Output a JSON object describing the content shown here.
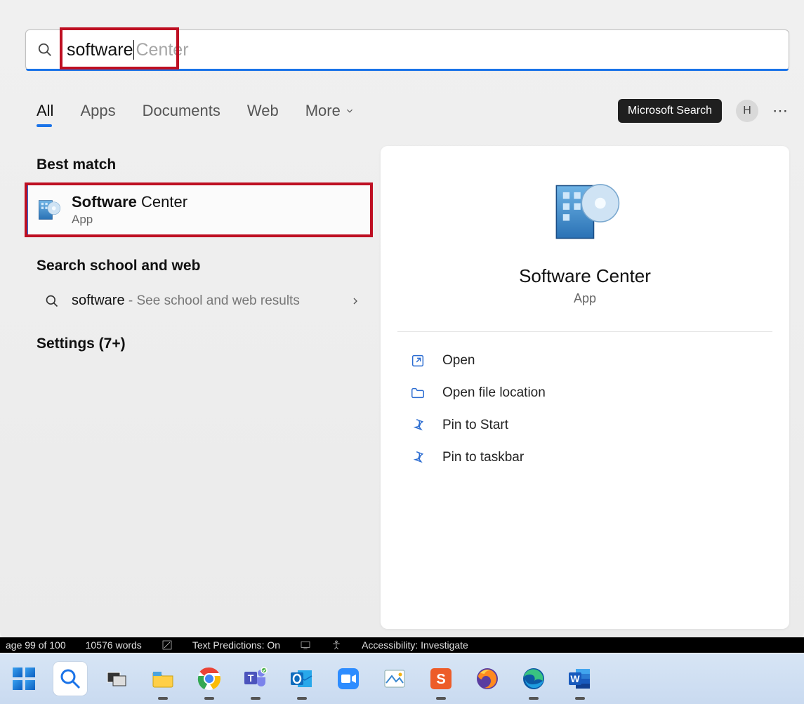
{
  "search": {
    "typed": "software",
    "suggestion_suffix": " Center"
  },
  "tabs": {
    "items": [
      {
        "label": "All",
        "active": true
      },
      {
        "label": "Apps",
        "active": false
      },
      {
        "label": "Documents",
        "active": false
      },
      {
        "label": "Web",
        "active": false
      },
      {
        "label": "More",
        "active": false,
        "chevron": true
      }
    ]
  },
  "header": {
    "ms_search_label": "Microsoft Search",
    "avatar_initial": "H"
  },
  "results": {
    "best_match_header": "Best match",
    "best_match": {
      "title_bold": "Software",
      "title_rest": " Center",
      "subtitle": "App"
    },
    "web_header": "Search school and web",
    "web_item": {
      "primary": "software",
      "secondary": " - See school and web results"
    },
    "settings_header": "Settings (7+)"
  },
  "preview": {
    "title": "Software Center",
    "subtitle": "App",
    "actions": [
      {
        "icon": "open",
        "label": "Open"
      },
      {
        "icon": "folder",
        "label": "Open file location"
      },
      {
        "icon": "pin",
        "label": "Pin to Start"
      },
      {
        "icon": "pin",
        "label": "Pin to taskbar"
      }
    ]
  },
  "word_status": {
    "page": "age 99 of 100",
    "words": "10576 words",
    "predictions": "Text Predictions: On",
    "accessibility": "Accessibility: Investigate"
  },
  "taskbar": {
    "items": [
      {
        "name": "start-button"
      },
      {
        "name": "search-button",
        "active": true
      },
      {
        "name": "task-view-button"
      },
      {
        "name": "file-explorer",
        "running": true
      },
      {
        "name": "chrome",
        "running": true
      },
      {
        "name": "teams",
        "running": true
      },
      {
        "name": "outlook",
        "running": true
      },
      {
        "name": "zoom"
      },
      {
        "name": "photos"
      },
      {
        "name": "snagit",
        "running": true
      },
      {
        "name": "firefox"
      },
      {
        "name": "edge",
        "running": true
      },
      {
        "name": "word",
        "running": true
      }
    ]
  }
}
